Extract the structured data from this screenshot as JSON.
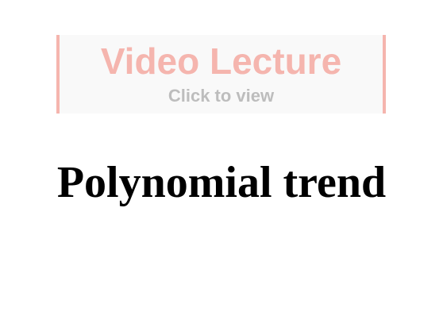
{
  "video_banner": {
    "title": "Video Lecture",
    "subtitle": "Click to view",
    "accent_color": "#f5b5ae",
    "subtitle_color": "#bdbdbd"
  },
  "page": {
    "title": "Polynomial trend"
  }
}
